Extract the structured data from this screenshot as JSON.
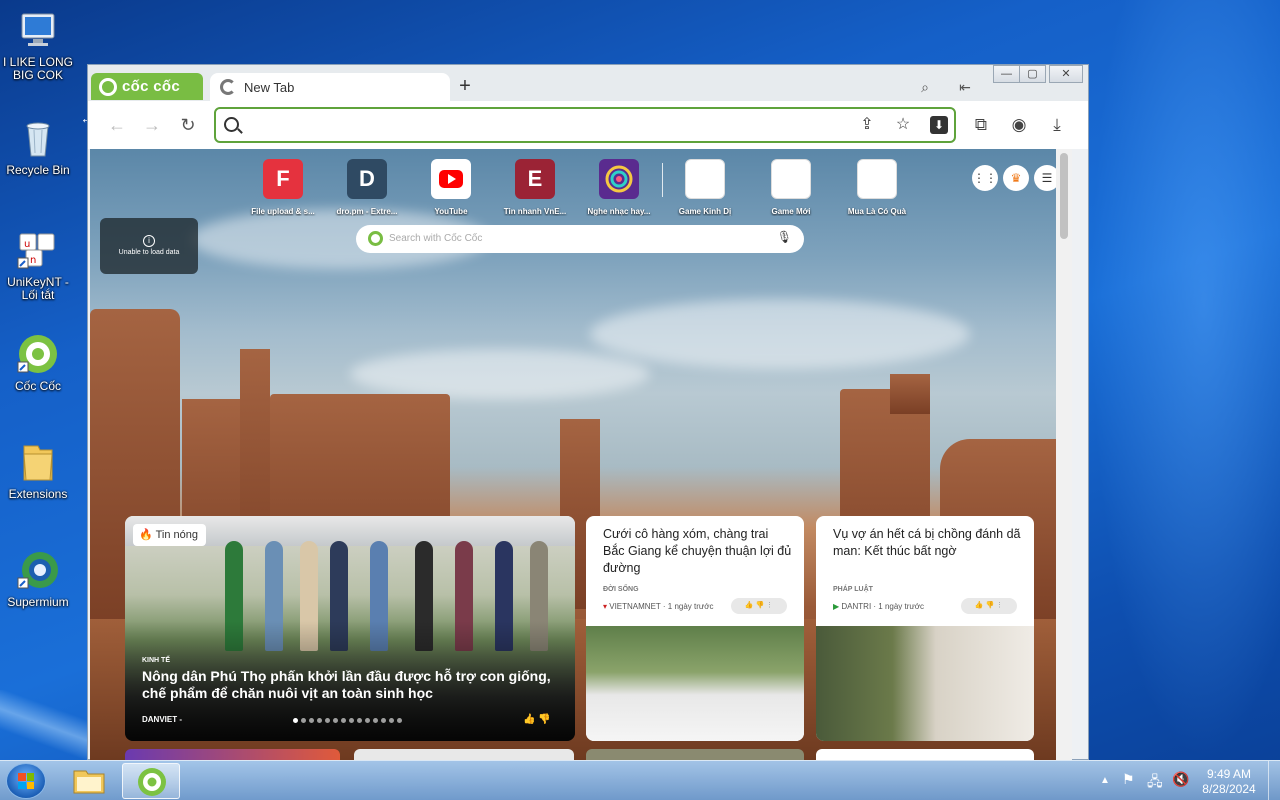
{
  "desktop": {
    "icons": [
      {
        "label": "I LIKE LONG BIG COK"
      },
      {
        "label": "Recycle Bin"
      },
      {
        "label": "UniKeyNT - Lối tắt"
      },
      {
        "label": "Cốc Cốc"
      },
      {
        "label": "Extensions"
      },
      {
        "label": "Supermium"
      }
    ]
  },
  "browser": {
    "brand": "cốc cốc",
    "tab_title": "New Tab",
    "new_tab_symbol": "+",
    "address_value": "",
    "address_placeholder": "",
    "speed_dial": [
      {
        "letter": "F",
        "label": "File upload & s...",
        "color": "#e5323e"
      },
      {
        "letter": "D",
        "label": "dro.pm - Extre...",
        "color": "#2f4a63"
      },
      {
        "letter": "",
        "label": "YouTube",
        "color": "#ffffff"
      },
      {
        "letter": "E",
        "label": "Tin nhanh VnE...",
        "color": "#9b2335"
      },
      {
        "letter": "",
        "label": "Nghe nhạc hay...",
        "color": "#5a2b8f"
      },
      {
        "letter": "",
        "label": "Game Kinh Dị",
        "color": "#ffffff"
      },
      {
        "letter": "",
        "label": "Game Mới",
        "color": "#ffffff"
      },
      {
        "letter": "",
        "label": "Mua Là Có Quà",
        "color": "#ffffff"
      }
    ],
    "unable_text": "Unable to load data",
    "search_placeholder": "Search with Cốc Cốc",
    "featured": {
      "badge": "Tin nóng",
      "category": "KINH TẾ",
      "title": "Nông dân Phú Thọ phấn khởi lần đầu được hỗ trợ con giống, chế phẩm để chăn nuôi vịt an toàn sinh học",
      "source": "DANVIET -"
    },
    "news": [
      {
        "title": "Cưới cô hàng xóm, chàng trai Bắc Giang kể chuyện thuận lợi đủ đường",
        "category": "ĐỜI SỐNG",
        "source": "VIETNAMNET",
        "time": "1 ngày trước"
      },
      {
        "title": "Vụ vợ án hết cá bị chồng đánh dã man: Kết thúc bất ngờ",
        "category": "PHÁP LUẬT",
        "source": "DANTRI",
        "time": "1 ngày trước"
      }
    ]
  },
  "taskbar": {
    "time": "9:49 AM",
    "date": "8/28/2024"
  }
}
